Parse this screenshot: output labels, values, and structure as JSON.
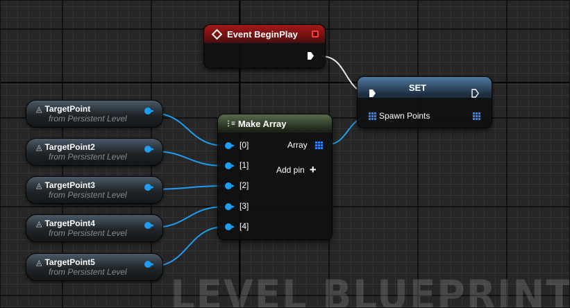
{
  "event_node": {
    "title": "Event BeginPlay"
  },
  "set_node": {
    "title": "SET",
    "variable_label": "Spawn Points"
  },
  "make_array_node": {
    "title": "Make Array",
    "inputs": [
      "[0]",
      "[1]",
      "[2]",
      "[3]",
      "[4]"
    ],
    "output_label": "Array",
    "add_pin_label": "Add pin",
    "add_pin_icon": "+"
  },
  "target_points": [
    {
      "name": "TargetPoint",
      "source": "from Persistent Level"
    },
    {
      "name": "TargetPoint2",
      "source": "from Persistent Level"
    },
    {
      "name": "TargetPoint3",
      "source": "from Persistent Level"
    },
    {
      "name": "TargetPoint4",
      "source": "from Persistent Level"
    },
    {
      "name": "TargetPoint5",
      "source": "from Persistent Level"
    }
  ],
  "watermark": "LEVEL BLUEPRINT",
  "colors": {
    "object_pin": "#1f9df0",
    "array_pin": "#2a86ff",
    "event_header": "#a51818",
    "exec_wire": "#ffffff"
  },
  "icons": {
    "event": "diamond-event-icon",
    "target_point": "eye-icon",
    "make_array": "array-grid-icon"
  }
}
